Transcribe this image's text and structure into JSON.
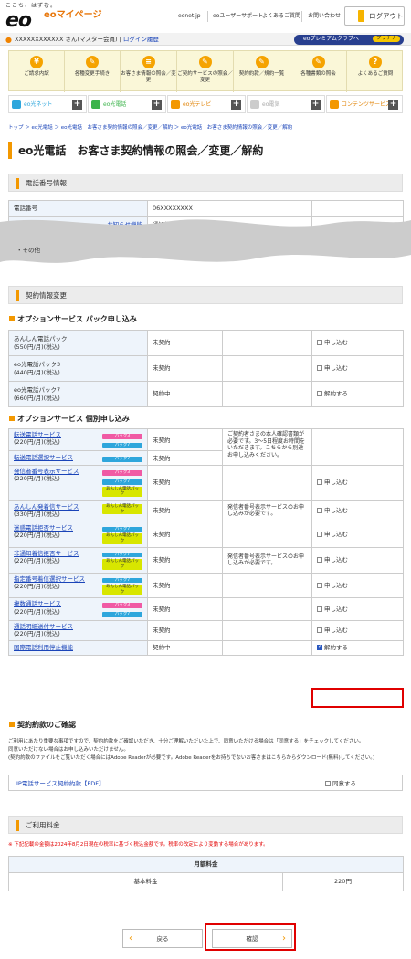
{
  "header": {
    "tagline": "ここち、はずむ。",
    "logo": "eo",
    "mypage": "eoマイページ",
    "links": [
      "eonet.jp",
      "eoユーザーサポート",
      "よくあるご質問",
      "お問い合わせ"
    ],
    "logout": "ログアウト"
  },
  "user": {
    "name": "XXXXXXXXXXXX さん(マスター会員)",
    "login_history": "ログイン履歴",
    "premium": "eoプレミアムクラブへ",
    "rank": "プラチナ"
  },
  "menu": [
    {
      "icon": "yen-icon",
      "glyph": "¥",
      "label": "ご請求内訳"
    },
    {
      "icon": "edit-icon",
      "glyph": "✎",
      "label": "各種変更手続き"
    },
    {
      "icon": "doc-icon",
      "glyph": "≡",
      "label": "お客さま情報の照会／変更"
    },
    {
      "icon": "service-icon",
      "glyph": "✎",
      "label": "ご契約サービスの照会／変更"
    },
    {
      "icon": "contract-icon",
      "glyph": "✎",
      "label": "契約約款／規約一覧"
    },
    {
      "icon": "form-icon",
      "glyph": "✎",
      "label": "各種書類の照会"
    },
    {
      "icon": "question-icon",
      "glyph": "?",
      "label": "よくあるご質問"
    }
  ],
  "services": [
    {
      "label": "eo光ネット",
      "color": "#2ea6dc"
    },
    {
      "label": "eo光電話",
      "color": "#3bb34a"
    },
    {
      "label": "eo光テレビ",
      "color": "#f39800"
    },
    {
      "label": "eo電気",
      "color": "#cccccc"
    },
    {
      "label": "コンテンツサービス",
      "color": "#f39800"
    }
  ],
  "breadcrumb": "トップ ＞ eo光電話 ＞ eo光電話　お客さま契約情報の照会／変更／解約 ＞ eo光電話　お客さま契約情報の照会／変更／解約",
  "page_title": "eo光電話　お客さま契約情報の照会／変更／解約",
  "phone_section": {
    "title": "電話番号情報",
    "number_label": "電話番号",
    "number_value": "06XXXXXXXX",
    "row2_label": "お知らせ機能",
    "row2_value": "通知指定額 50",
    "row3_label": "・その他"
  },
  "contract_section": {
    "title": "契約情報変更"
  },
  "pack": {
    "title": "オプションサービス パック申し込み",
    "rows": [
      {
        "name": "あんしん電話パック\n(550円/月)(税込)",
        "status": "未契約",
        "action": "申し込む",
        "checked": false
      },
      {
        "name": "eo光電話パック3\n(440円/月)(税込)",
        "status": "未契約",
        "action": "申し込む",
        "checked": false
      },
      {
        "name": "eo光電話パック7\n(660円/月)(税込)",
        "status": "契約中",
        "action": "解約する",
        "checked": false
      }
    ]
  },
  "individual": {
    "title": "オプションサービス 個別申し込み",
    "rows": [
      {
        "name": "転送電話サービス",
        "price": "(220円/月)(税込)",
        "tags": [
          "パック3",
          "パック7"
        ],
        "status": "未契約",
        "note": "ご契約者さまの本人確認書類が必要です。3〜5日程度お時間をいただきます。こちらから別途お申し込みください。",
        "action": "",
        "checked": false
      },
      {
        "name": "転送電話選択サービス",
        "price": "",
        "tags": [
          "パック7"
        ],
        "status": "未契約",
        "note": "",
        "action": "",
        "checked": false
      },
      {
        "name": "発信者番号表示サービス",
        "price": "(220円/月)(税込)",
        "tags": [
          "パック3",
          "パック7",
          "あんしん電話パック"
        ],
        "status": "未契約",
        "note": "",
        "action": "申し込む",
        "checked": false
      },
      {
        "name": "あんしん発着信サービス",
        "price": "(330円/月)(税込)",
        "tags": [
          "あんしん電話パック"
        ],
        "status": "未契約",
        "note": "発信者番号表示サービスのお申し込みが必要です。",
        "action": "申し込む",
        "checked": false
      },
      {
        "name": "迷惑電話拒否サービス",
        "price": "(220円/月)(税込)",
        "tags": [
          "パック7",
          "あんしん電話パック"
        ],
        "status": "未契約",
        "note": "",
        "action": "申し込む",
        "checked": false
      },
      {
        "name": "非通知着信拒否サービス",
        "price": "(220円/月)(税込)",
        "tags": [
          "パック7",
          "あんしん電話パック"
        ],
        "status": "未契約",
        "note": "発信者番号表示サービスのお申し込みが必要です。",
        "action": "申し込む",
        "checked": false
      },
      {
        "name": "指定番号着信選択サービス",
        "price": "(220円/月)(税込)",
        "tags": [
          "パック7",
          "あんしん電話パック"
        ],
        "status": "未契約",
        "note": "",
        "action": "申し込む",
        "checked": false
      },
      {
        "name": "複数通話サービス",
        "price": "(220円/月)(税込)",
        "tags": [
          "パック3",
          "パック7"
        ],
        "status": "未契約",
        "note": "",
        "action": "申し込む",
        "checked": false
      },
      {
        "name": "通話明細送付サービス",
        "price": "(220円/月)(税込)",
        "tags": [],
        "status": "未契約",
        "note": "",
        "action": "申し込む",
        "checked": false
      },
      {
        "name": "国際電話利用停止機能",
        "price": "",
        "tags": [],
        "status": "契約中",
        "note": "",
        "action": "解約する",
        "checked": true
      }
    ]
  },
  "agreement": {
    "title": "契約約款のご確認",
    "text1": "ご利用にあたり重要な事項ですので、契約約款をご確認いただき、十分ご理解いただいた上で、同意いただける場合は「同意する」をチェックしてください。",
    "text2": "同意いただけない場合はお申し込みいただけません。",
    "text3": "(契約約款のファイルをご覧いただく場合にはAdobe Readerが必要です。Adobe Readerをお持ちでないお客さまはこちらからダウンロード(無料)してください。)",
    "pdf": "IP電話サービス契約約款【PDF】",
    "agree": "同意する"
  },
  "fee": {
    "title": "ご利用料金",
    "note": "※ 下記記載の金額は2024年8月2日現在の税率に基づく税込金額です。税率の改定により変動する場合があります。",
    "header": "月額料金",
    "label": "基本料金",
    "value": "220円"
  },
  "buttons": {
    "back": "戻る",
    "confirm": "確認"
  }
}
